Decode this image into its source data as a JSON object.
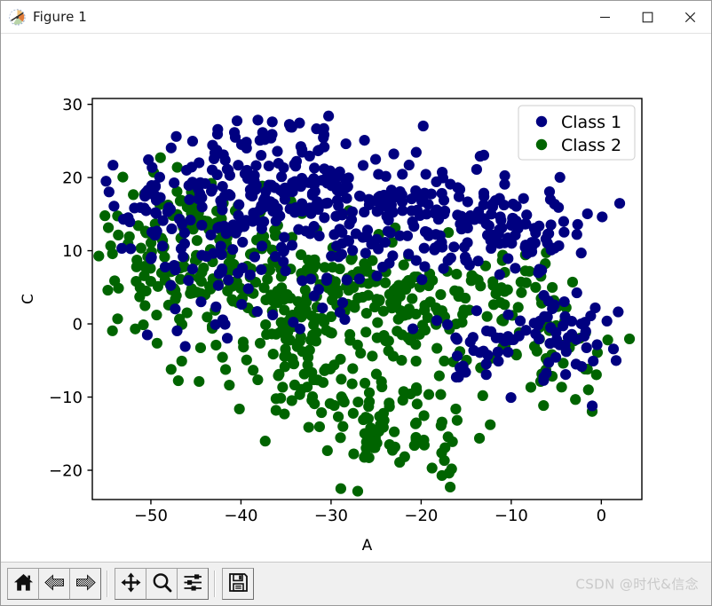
{
  "window": {
    "title": "Figure 1",
    "icon": "matplotlib-icon",
    "controls": {
      "minimize_label": "─",
      "maximize_label": "□",
      "close_label": "✕"
    }
  },
  "toolbar": {
    "buttons": [
      {
        "name": "home-button",
        "icon": "home-icon",
        "tooltip": "Reset original view"
      },
      {
        "name": "back-button",
        "icon": "arrow-left-icon",
        "tooltip": "Back to previous view"
      },
      {
        "name": "forward-button",
        "icon": "arrow-right-icon",
        "tooltip": "Forward to next view"
      },
      {
        "name": "pan-button",
        "icon": "move-arrows-icon",
        "tooltip": "Pan axes with left mouse, zoom with right"
      },
      {
        "name": "zoom-button",
        "icon": "magnifier-icon",
        "tooltip": "Zoom to rectangle"
      },
      {
        "name": "configure-subplots-button",
        "icon": "sliders-icon",
        "tooltip": "Configure subplots"
      },
      {
        "name": "save-button",
        "icon": "floppy-disk-icon",
        "tooltip": "Save the figure"
      }
    ],
    "watermark": "CSDN @时代&信念"
  },
  "colors": {
    "class1": "#000080",
    "class2": "#006400",
    "axis": "#000000",
    "figure_background": "#ffffff",
    "toolbar_background": "#f0f0f0",
    "watermark": "#c9c9c9"
  },
  "chart_data": {
    "type": "scatter",
    "title": "",
    "xlabel": "A",
    "ylabel": "C",
    "xlim": [
      -56.5,
      4.5
    ],
    "ylim": [
      -24.0,
      30.8
    ],
    "xticks": [
      -50,
      -40,
      -30,
      -20,
      -10,
      0
    ],
    "yticks": [
      -20,
      -10,
      0,
      10,
      20,
      30
    ],
    "xticklabels": [
      "−50",
      "−40",
      "−30",
      "−20",
      "−10",
      "0"
    ],
    "yticklabels": [
      "−20",
      "−10",
      "0",
      "10",
      "20",
      "30"
    ],
    "grid": false,
    "legend_position": "upper right",
    "marker_size": 9,
    "series": [
      {
        "name": "Class 1",
        "color": "#000080",
        "n_points": 560,
        "clusters": [
          {
            "cx": -38.0,
            "cy": 19.5,
            "sx": 6.2,
            "sy": 4.4,
            "rho": 0.15,
            "n": 150
          },
          {
            "cx": -27.0,
            "cy": 16.0,
            "sx": 6.0,
            "sy": 4.0,
            "rho": -0.1,
            "n": 130
          },
          {
            "cx": -14.0,
            "cy": 13.5,
            "sx": 5.5,
            "sy": 3.6,
            "rho": 0.1,
            "n": 95
          },
          {
            "cx": -49.5,
            "cy": 16.0,
            "sx": 3.0,
            "sy": 3.4,
            "rho": 0.0,
            "n": 45
          },
          {
            "cx": -44.0,
            "cy": 9.0,
            "sx": 3.0,
            "sy": 4.0,
            "rho": 0.3,
            "n": 30
          },
          {
            "cx": -34.0,
            "cy": 5.0,
            "sx": 5.5,
            "sy": 3.8,
            "rho": 0.2,
            "n": 40
          },
          {
            "cx": -8.5,
            "cy": 12.5,
            "sx": 3.4,
            "sy": 3.2,
            "rho": 0.0,
            "n": 35
          },
          {
            "cx": -12.0,
            "cy": -2.5,
            "sx": 4.2,
            "sy": 3.4,
            "rho": 0.25,
            "n": 50
          },
          {
            "cx": -3.0,
            "cy": -2.0,
            "sx": 3.0,
            "sy": 3.2,
            "rho": 0.0,
            "n": 35
          }
        ]
      },
      {
        "name": "Class 2",
        "color": "#006400",
        "n_points": 620,
        "clusters": [
          {
            "cx": -33.0,
            "cy": 3.0,
            "sx": 6.5,
            "sy": 4.2,
            "rho": 0.1,
            "n": 160
          },
          {
            "cx": -44.0,
            "cy": 7.5,
            "sx": 4.2,
            "sy": 4.8,
            "rho": 0.25,
            "n": 90
          },
          {
            "cx": -22.5,
            "cy": 4.0,
            "sx": 5.5,
            "sy": 4.0,
            "rho": -0.1,
            "n": 95
          },
          {
            "cx": -51.0,
            "cy": 8.0,
            "sx": 2.6,
            "sy": 4.5,
            "rho": 0.0,
            "n": 45
          },
          {
            "cx": -30.0,
            "cy": -7.5,
            "sx": 5.5,
            "sy": 3.2,
            "rho": 0.1,
            "n": 70
          },
          {
            "cx": -22.0,
            "cy": -15.0,
            "sx": 4.2,
            "sy": 3.6,
            "rho": 0.1,
            "n": 75
          },
          {
            "cx": -10.0,
            "cy": 4.0,
            "sx": 4.0,
            "sy": 3.6,
            "rho": 0.2,
            "n": 45
          },
          {
            "cx": -5.0,
            "cy": -4.5,
            "sx": 3.8,
            "sy": 3.6,
            "rho": 0.0,
            "n": 40
          },
          {
            "cx": -45.5,
            "cy": 16.5,
            "sx": 2.8,
            "sy": 2.6,
            "rho": 0.0,
            "n": 30
          }
        ]
      }
    ]
  }
}
